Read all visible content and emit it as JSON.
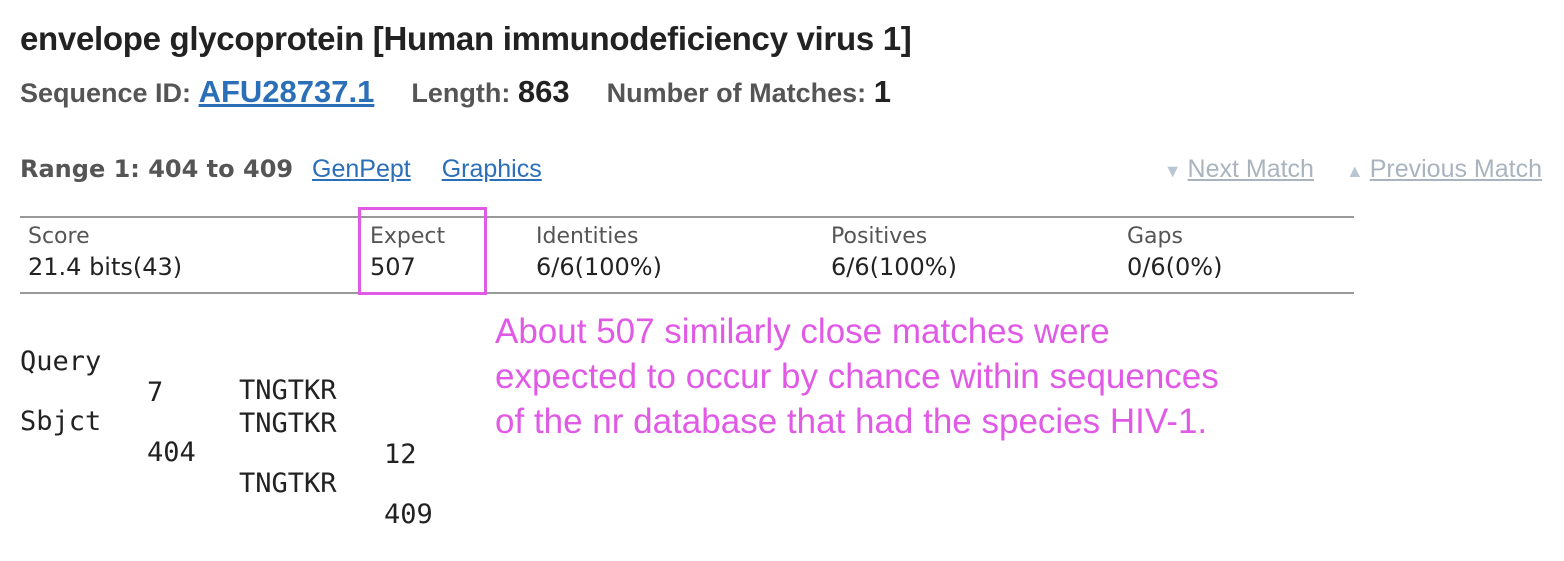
{
  "title": "envelope glycoprotein [Human immunodeficiency virus 1]",
  "meta": {
    "sequence_id_label": "Sequence ID:",
    "sequence_id": "AFU28737.1",
    "length_label": "Length:",
    "length": "863",
    "matches_label": "Number of Matches:",
    "matches": "1"
  },
  "range": {
    "label": "Range 1: 404 to 409",
    "genpept": "GenPept",
    "graphics": "Graphics"
  },
  "nav": {
    "next": "Next Match",
    "previous": "Previous Match"
  },
  "stats": {
    "score": {
      "header": "Score",
      "value": "21.4 bits(43)"
    },
    "expect": {
      "header": "Expect",
      "value": "507"
    },
    "identities": {
      "header": "Identities",
      "value": "6/6(100%)"
    },
    "positives": {
      "header": "Positives",
      "value": "6/6(100%)"
    },
    "gaps": {
      "header": "Gaps",
      "value": "0/6(0%)"
    }
  },
  "alignment": {
    "query": {
      "label": "Query",
      "start": "7",
      "seq": "TNGTKR",
      "end": "12"
    },
    "midline": "TNGTKR",
    "sbjct": {
      "label": "Sbjct",
      "start": "404",
      "seq": "TNGTKR",
      "end": "409"
    }
  },
  "annotation": {
    "line1": "About 507 similarly close matches were",
    "line2": "expected to occur by chance within sequences",
    "line3": "of the nr database that had the species HIV-1.",
    "color": "#e05ae6"
  },
  "colors": {
    "link": "#2a6fb8",
    "disabled_link": "#a9b4bf",
    "highlight": "#e05ae6"
  }
}
